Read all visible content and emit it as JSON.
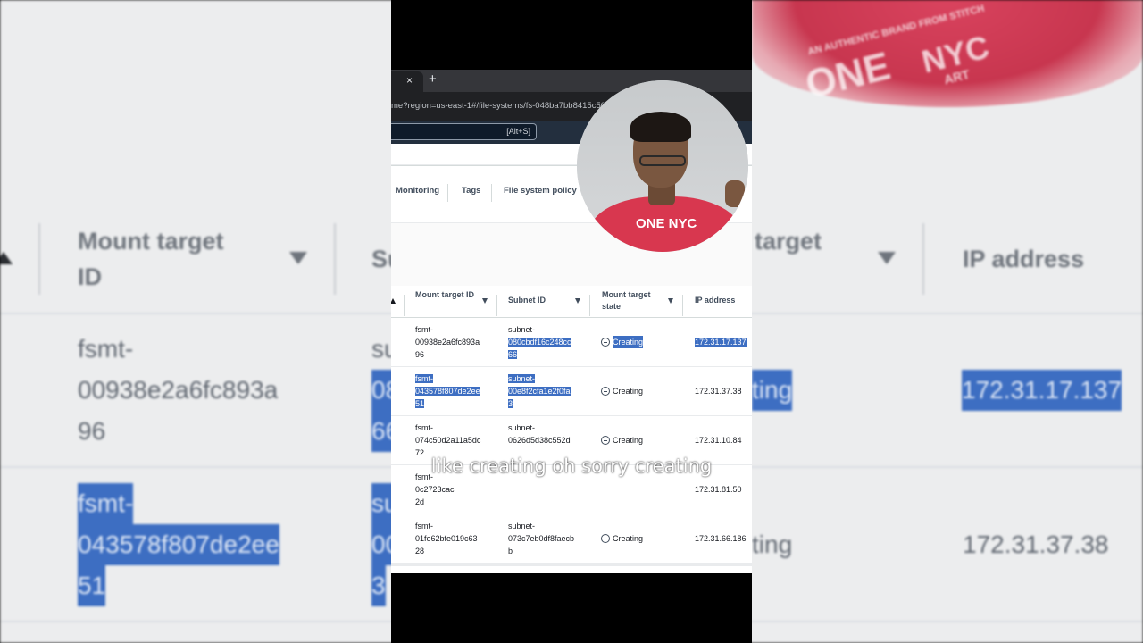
{
  "browser": {
    "tab_close": "×",
    "new_tab": "+",
    "url": "me?region=us-east-1#/file-systems/fs-048ba7bb8415c507"
  },
  "aws": {
    "search_shortcut": "[Alt+S]"
  },
  "page_tabs": [
    "Monitoring",
    "Tags",
    "File system policy"
  ],
  "table": {
    "columns": [
      {
        "label": "Mount target ID"
      },
      {
        "label": "Subnet ID"
      },
      {
        "label": "Mount target state"
      },
      {
        "label": "IP address"
      }
    ],
    "rows": [
      {
        "mount_target_id": [
          "fsmt-",
          "00938e2a6fc893a",
          "96"
        ],
        "subnet_id": [
          "subnet-",
          "080cbdf16c248cc",
          "66"
        ],
        "state": "Creating",
        "ip": "172.31.17.137"
      },
      {
        "mount_target_id": [
          "fsmt-",
          "043578f807de2ee",
          "51"
        ],
        "subnet_id": [
          "subnet-",
          "00e8f2cfa1e2f0fa",
          "3"
        ],
        "state": "Creating",
        "ip": "172.31.37.38"
      },
      {
        "mount_target_id": [
          "fsmt-",
          "074c50d2a11a5dc",
          "72"
        ],
        "subnet_id": [
          "subnet-",
          "0626d5d38c552d",
          ""
        ],
        "state": "Creating",
        "ip": "172.31.10.84"
      },
      {
        "mount_target_id": [
          "fsmt-",
          "0c2723cac",
          "2d"
        ],
        "subnet_id": [
          "",
          "",
          ""
        ],
        "state": "",
        "ip": "172.31.81.50"
      },
      {
        "mount_target_id": [
          "fsmt-",
          "01fe62bfe019c63",
          "28"
        ],
        "subnet_id": [
          "subnet-",
          "073c7eb0df8faecb",
          "b"
        ],
        "state": "Creating",
        "ip": "172.31.66.186"
      }
    ]
  },
  "caption": "like creating oh sorry creating",
  "background": {
    "header_mount": [
      "Mount target",
      "ID"
    ],
    "header_su": "Su",
    "header_target": "target",
    "header_ip": "IP address",
    "row1_id": [
      "fsmt-",
      "00938e2a6fc893a",
      "96"
    ],
    "row2_id": [
      "fsmt-",
      "043578f807de2ee",
      "51"
    ],
    "row2_mid": "ting",
    "row3_mid": "ting",
    "ip1": "172.31.17.137",
    "ip2": "172.31.37.38",
    "mid_fragments": [
      "su",
      "08",
      "66",
      "su",
      "00",
      "3"
    ],
    "shirt_text": [
      "AN AUTHENTIC BRAND FROM STITCH",
      "ONE",
      "NYC",
      "ART"
    ]
  },
  "webcam": {
    "shirt_logo": "ONE NYC"
  }
}
